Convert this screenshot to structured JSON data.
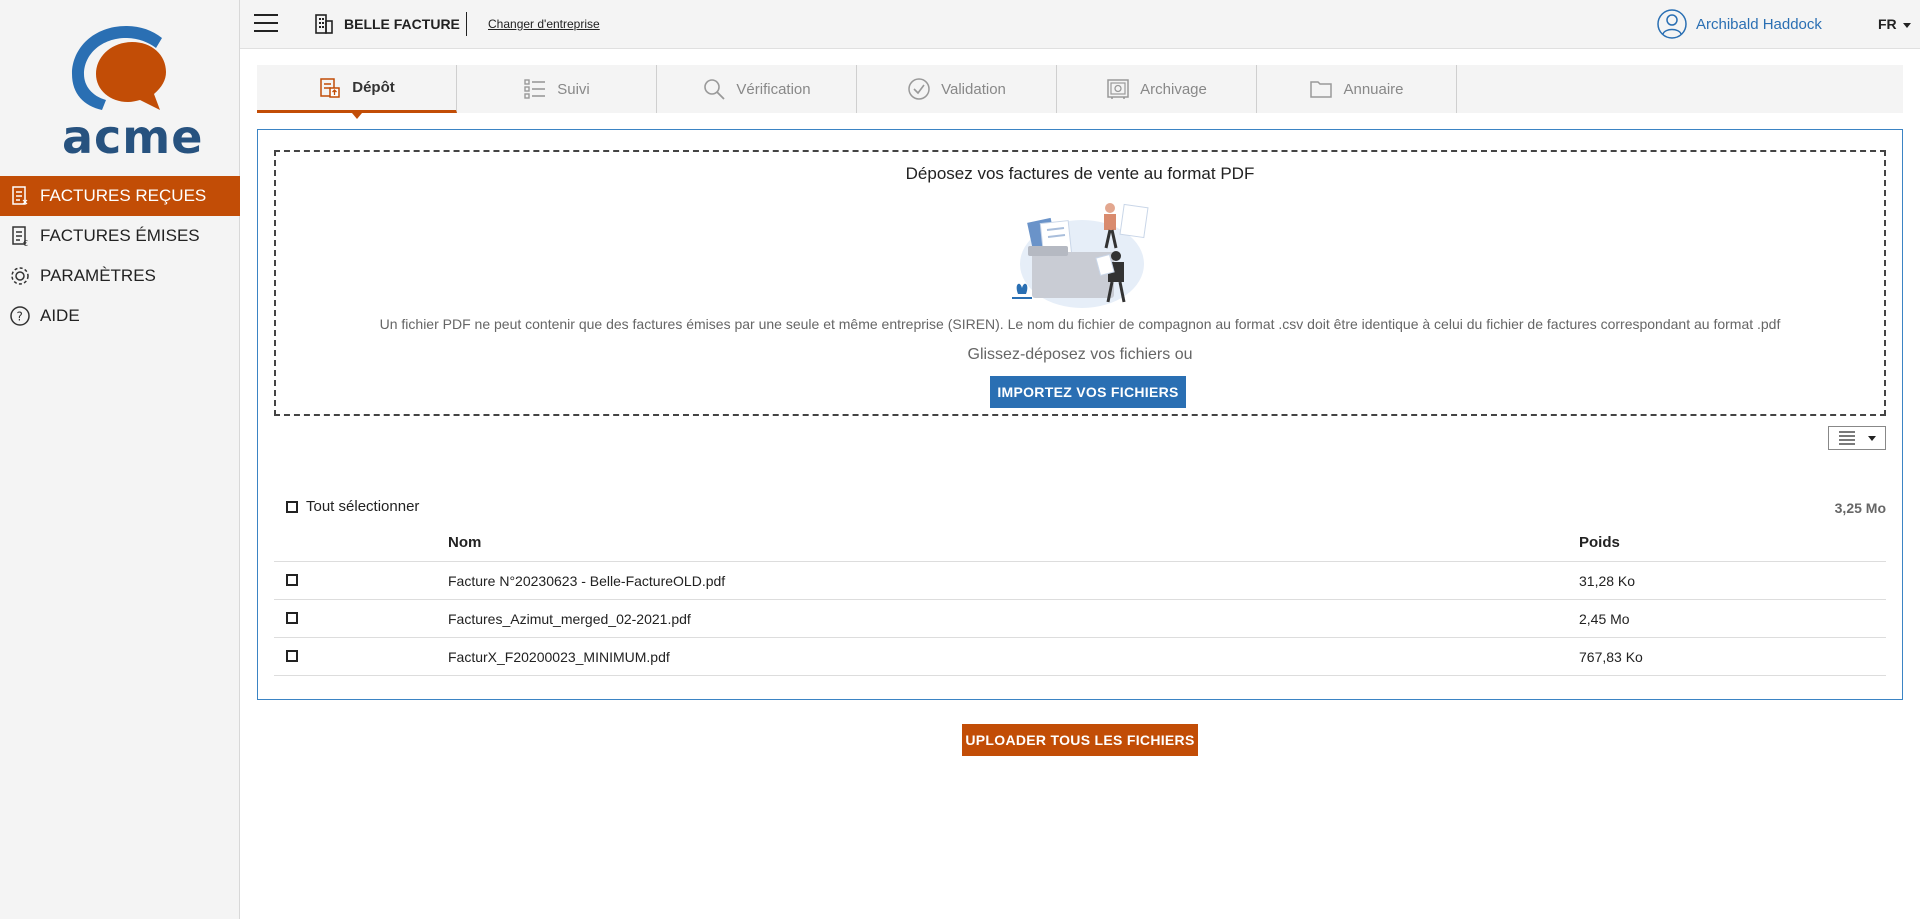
{
  "brand": {
    "logo_text": "acme",
    "logo_color": "#27527f",
    "accent_color": "#c24d06",
    "primary_color": "#2a6fb3"
  },
  "sidebar": {
    "items": [
      {
        "label": "FACTURES REÇUES",
        "icon": "invoice-received-icon",
        "active": true
      },
      {
        "label": "FACTURES ÉMISES",
        "icon": "invoice-issued-icon",
        "active": false
      },
      {
        "label": "PARAMÈTRES",
        "icon": "gear-icon",
        "active": false
      },
      {
        "label": "AIDE",
        "icon": "help-icon",
        "active": false
      }
    ]
  },
  "header": {
    "company_name": "BELLE FACTURE",
    "change_company_label": "Changer d'entreprise",
    "user_name": "Archibald Haddock",
    "language": "FR"
  },
  "tabs": [
    {
      "label": "Dépôt",
      "icon": "deposit-icon",
      "active": true
    },
    {
      "label": "Suivi",
      "icon": "list-icon",
      "active": false
    },
    {
      "label": "Vérification",
      "icon": "search-icon",
      "active": false
    },
    {
      "label": "Validation",
      "icon": "check-circle-icon",
      "active": false
    },
    {
      "label": "Archivage",
      "icon": "safe-icon",
      "active": false
    },
    {
      "label": "Annuaire",
      "icon": "folder-icon",
      "active": false
    }
  ],
  "dropzone": {
    "title": "Déposez vos factures de vente au format PDF",
    "info": "Un fichier PDF ne peut contenir que des factures émises par une seule et même entreprise (SIREN). Le nom du fichier de compagnon au format .csv doit être identique à celui du fichier de factures correspondant au format .pdf",
    "drag_text": "Glissez-déposez vos fichiers ou",
    "import_button": "IMPORTEZ VOS FICHIERS"
  },
  "files": {
    "select_all_label": "Tout sélectionner",
    "total_size": "3,25 Mo",
    "columns": {
      "name": "Nom",
      "size": "Poids"
    },
    "rows": [
      {
        "name": "Facture N°20230623 - Belle-FactureOLD.pdf",
        "size": "31,28 Ko"
      },
      {
        "name": "Factures_Azimut_merged_02-2021.pdf",
        "size": "2,45 Mo"
      },
      {
        "name": "FacturX_F20200023_MINIMUM.pdf",
        "size": "767,83 Ko"
      }
    ]
  },
  "upload_button": "UPLOADER TOUS LES FICHIERS"
}
